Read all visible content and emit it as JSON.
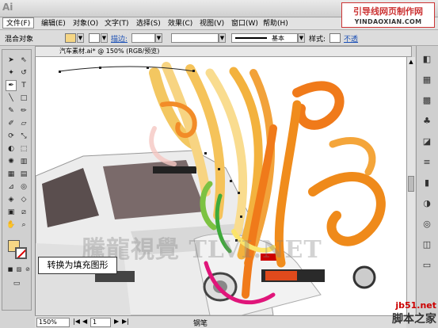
{
  "app": {
    "logo": "Ai"
  },
  "watermark_top": {
    "line1": "引导线网页制作网",
    "line2": "YINDAOXIAN.COM"
  },
  "menu": [
    "文件(F)",
    "编辑(E)",
    "对象(O)",
    "文字(T)",
    "选择(S)",
    "效果(C)",
    "视图(V)",
    "窗口(W)",
    "帮助(H)"
  ],
  "options_bar": {
    "object_type": "混合对象",
    "stroke_label": "描边:",
    "style_value": "基本",
    "style_label": "样式:",
    "opacity_label": "不透"
  },
  "document": {
    "tab_title": "汽车素材.ai* @ 150% (RGB/预览)"
  },
  "canvas": {
    "watermark_text": "TLVI.NET",
    "watermark_cn": "騰龍視覺"
  },
  "callout": {
    "text": "转换为填充图形"
  },
  "status": {
    "zoom": "150%",
    "page": "1",
    "tool": "钢笔"
  },
  "corner_watermark": {
    "url": "jb51.net",
    "name": "脚本之家"
  },
  "colors": {
    "fill": "#f5d685",
    "orange": "#f07a1a",
    "yellow": "#f2c35a",
    "magenta": "#e0157a",
    "green": "#7cc242"
  }
}
